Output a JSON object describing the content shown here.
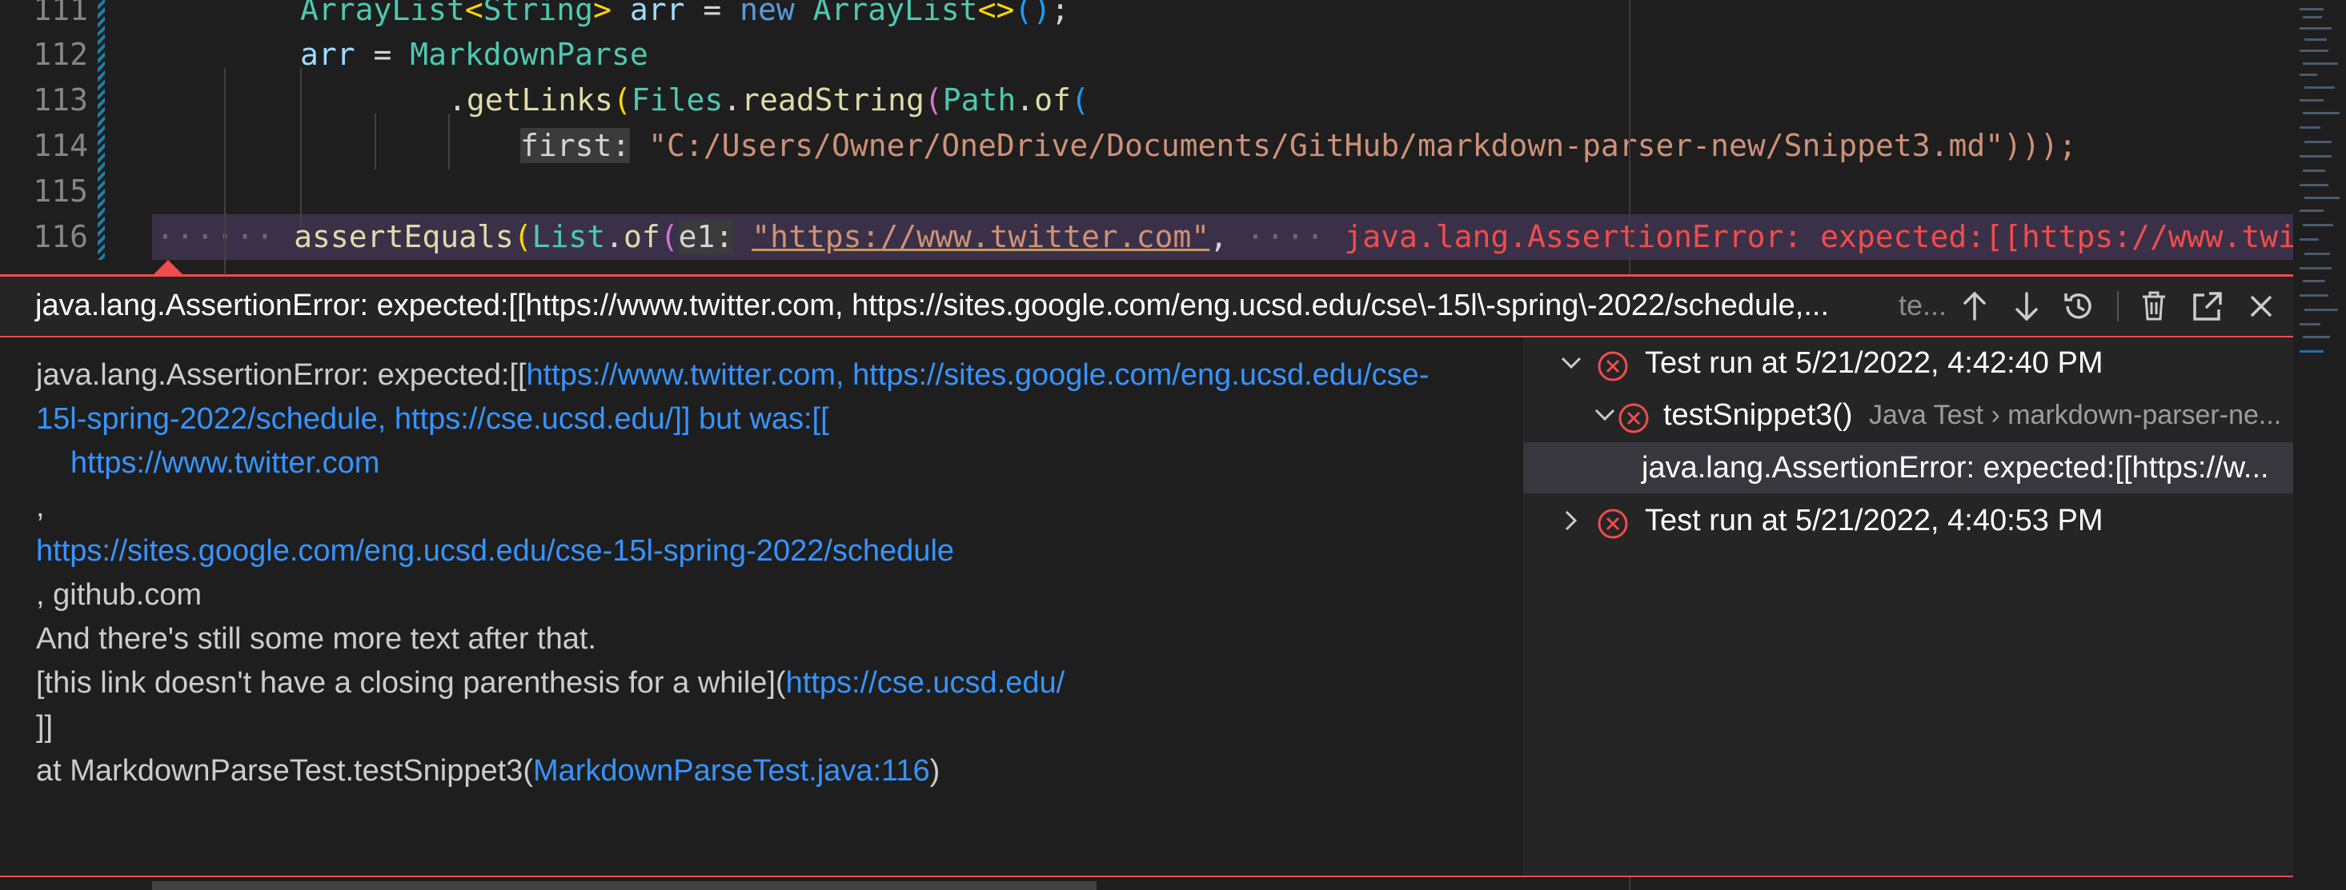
{
  "editor": {
    "lines": [
      {
        "num": "111",
        "code": "ArrayList<String> arr = new ArrayList<>();"
      },
      {
        "num": "112",
        "code": "arr = MarkdownParse"
      },
      {
        "num": "113",
        "code": ".getLinks(Files.readString(Path.of("
      },
      {
        "num": "114",
        "hint": "first:",
        "code": "\"C:/Users/Owner/OneDrive/Documents/GitHub/markdown-parser-new/Snippet3.md\")));"
      },
      {
        "num": "115",
        "code": ""
      },
      {
        "num": "116",
        "hint": "e1:",
        "code": "assertEquals(List.of(",
        "string": "\"https://www.twitter.com\"",
        "after": ",",
        "inline_error": "java.lang.AssertionError: expected:[[https://www.twi"
      }
    ],
    "tokens": {
      "l111": [
        "ArrayList",
        "<",
        "String",
        ">",
        " arr",
        " = ",
        "new",
        " ",
        "ArrayList",
        "<>",
        "(",
        ")",
        ";"
      ],
      "l112": [
        "arr",
        " = ",
        "MarkdownParse"
      ],
      "l113": [
        ".",
        "getLinks",
        "(",
        "Files",
        ".",
        "readString",
        "(",
        "Path",
        ".",
        "of",
        "("
      ],
      "l116": [
        "assertEquals",
        "(",
        "List",
        ".",
        "of",
        "("
      ]
    }
  },
  "peek": {
    "title": "java.lang.AssertionError: expected:[[https://www.twitter.com, https://sites.google.com/eng.ucsd.edu/cse\\-15l\\-spring\\-2022/schedule,...",
    "subtitle": "te...",
    "buttons": [
      {
        "name": "previous-arrow-icon"
      },
      {
        "name": "next-arrow-icon"
      },
      {
        "name": "history-icon"
      },
      {
        "name": "trash-icon"
      },
      {
        "name": "open-external-icon"
      },
      {
        "name": "close-icon"
      }
    ],
    "message": {
      "l1_a": "java.lang.AssertionError: expected:[[",
      "l1_b": "https://www.twitter.com, https://sites.google.com/eng.ucsd.edu/cse-",
      "l2_a": "15l-spring-2022/schedule, https://cse.ucsd.edu/]] but was:[[",
      "l3": "https://www.twitter.com",
      "l4": ",",
      "l5": "https://sites.google.com/eng.ucsd.edu/cse-15l-spring-2022/schedule",
      "l6": ", github.com",
      "l7": "And there's still some more text after that.",
      "l8_a": "[this link doesn't have a closing parenthesis for a while](",
      "l8_b": "https://cse.ucsd.edu/",
      "l9": "]]",
      "l10_a": " at MarkdownParseTest.testSnippet3(",
      "l10_b": "MarkdownParseTest.java:116",
      "l10_c": ")"
    },
    "tree": [
      {
        "label": "Test run at 5/21/2022, 4:42:40 PM",
        "expanded": true
      },
      {
        "label": "testSnippet3()",
        "description": "Java Test › markdown-parser-ne...",
        "expanded": true
      },
      {
        "label": "java.lang.AssertionError: expected:[[https://w..."
      },
      {
        "label": "Test run at 5/21/2022, 4:40:53 PM",
        "expanded": false
      }
    ]
  },
  "colors": {
    "error": "#f14c4c",
    "link": "#3794ff",
    "background": "#1e1e1e"
  }
}
